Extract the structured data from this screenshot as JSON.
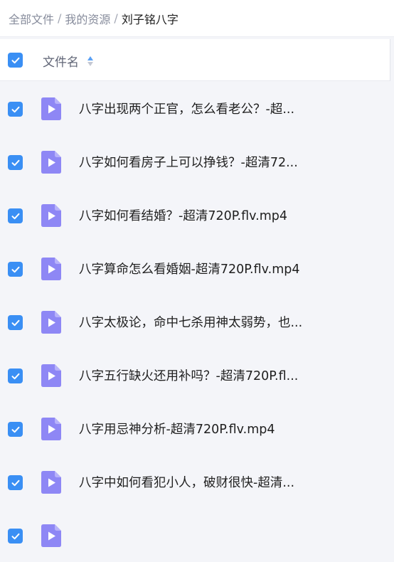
{
  "breadcrumb": {
    "root": "全部文件",
    "parent": "我的资源",
    "current": "刘子铭八字",
    "separator": "/"
  },
  "header": {
    "column_name": "文件名",
    "select_all_checked": true
  },
  "files": [
    {
      "name": "八字出现两个正官，怎么看老公？-超...",
      "type": "video",
      "checked": true
    },
    {
      "name": "八字如何看房子上可以挣钱？-超清72...",
      "type": "video",
      "checked": true
    },
    {
      "name": "八字如何看结婚？-超清720P.flv.mp4",
      "type": "video",
      "checked": true
    },
    {
      "name": "八字算命怎么看婚姻-超清720P.flv.mp4",
      "type": "video",
      "checked": true
    },
    {
      "name": "八字太极论，命中七杀用神太弱势，也...",
      "type": "video",
      "checked": true
    },
    {
      "name": "八字五行缺火还用补吗？-超清720P.fl...",
      "type": "video",
      "checked": true
    },
    {
      "name": "八字用忌神分析-超清720P.flv.mp4",
      "type": "video",
      "checked": true
    },
    {
      "name": "八字中如何看犯小人，破财很快-超清...",
      "type": "video",
      "checked": true
    },
    {
      "name": "",
      "type": "video",
      "checked": true
    }
  ],
  "colors": {
    "accent": "#3a8ff4",
    "video_icon": "#8e87f5",
    "background": "#f4f5f9"
  },
  "icons": {
    "checkbox": "check-icon",
    "file": "video-file-icon",
    "sort": "sort-icon"
  }
}
